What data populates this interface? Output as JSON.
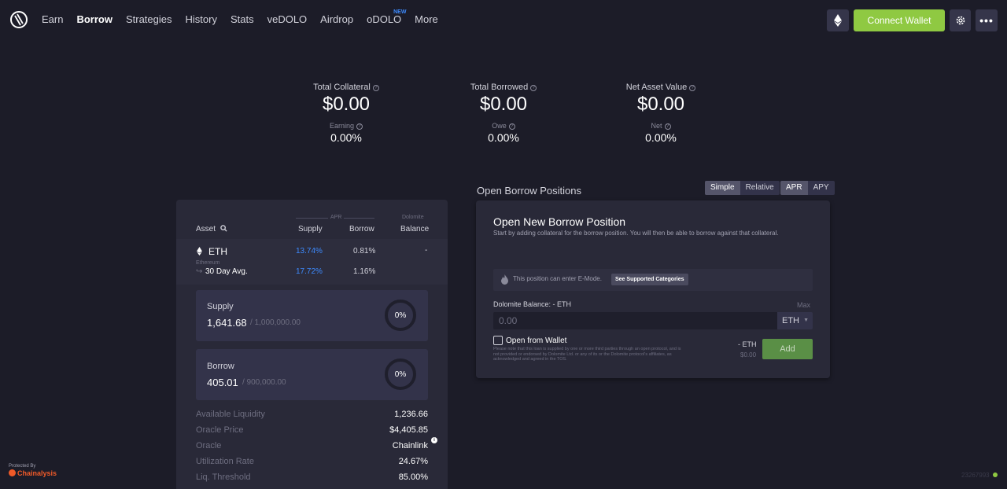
{
  "nav": {
    "links": [
      {
        "label": "Earn",
        "active": false
      },
      {
        "label": "Borrow",
        "active": true
      },
      {
        "label": "Strategies",
        "active": false
      },
      {
        "label": "History",
        "active": false
      },
      {
        "label": "Stats",
        "active": false
      },
      {
        "label": "veDOLO",
        "active": false
      },
      {
        "label": "Airdrop",
        "active": false
      },
      {
        "label": "oDOLO",
        "active": false,
        "badge": "NEW"
      },
      {
        "label": "More",
        "active": false
      }
    ],
    "connect_label": "Connect Wallet",
    "more_label": "•••",
    "icons": {
      "network": "ethereum-icon",
      "settings": "gear-icon",
      "logo": "dolomite-logo"
    }
  },
  "summary": [
    {
      "label": "Total Collateral",
      "value": "$0.00",
      "sub_label": "Earning",
      "sub_value": "0.00%"
    },
    {
      "label": "Total Borrowed",
      "value": "$0.00",
      "sub_label": "Owe",
      "sub_value": "0.00%"
    },
    {
      "label": "Net Asset Value",
      "value": "$0.00",
      "sub_label": "Net",
      "sub_value": "0.00%"
    }
  ],
  "market": {
    "header": {
      "asset": "Asset",
      "apr": "APR",
      "supply": "Supply",
      "borrow": "Borrow",
      "balance_top": "Dolomite",
      "balance": "Balance"
    },
    "row": {
      "symbol": "ETH",
      "name": "Ethereum",
      "supply_apr": "13.74%",
      "borrow_apr": "0.81%",
      "balance": "-"
    },
    "avg": {
      "label": "30 Day Avg.",
      "supply_apr": "17.72%",
      "borrow_apr": "1.16%"
    },
    "supply_card": {
      "label": "Supply",
      "amount": "1,641.68",
      "cap": "/ 1,000,000.00",
      "pct": "0%"
    },
    "borrow_card": {
      "label": "Borrow",
      "amount": "405.01",
      "cap": "/ 900,000.00",
      "pct": "0%"
    },
    "stats": [
      {
        "key": "Available Liquidity",
        "value": "1,236.66"
      },
      {
        "key": "Oracle Price",
        "value": "$4,405.85"
      },
      {
        "key": "Oracle",
        "value": "Chainlink"
      },
      {
        "key": "Utilization Rate",
        "value": "24.67%"
      },
      {
        "key": "Liq. Threshold",
        "value": "85.00%"
      }
    ]
  },
  "positions": {
    "title": "Open Borrow Positions",
    "mode_toggle": [
      "Simple",
      "Relative"
    ],
    "mode_active": "Simple",
    "rate_toggle": [
      "APR",
      "APY"
    ],
    "rate_active": "APR"
  },
  "new_position": {
    "title": "Open New Borrow Position",
    "subtitle": "Start by adding collateral for the borrow position. You will then be able to borrow against that collateral.",
    "emode_text": "This position can enter E-Mode.",
    "emode_button": "See Supported Categories",
    "balance_label": "Dolomite Balance: - ETH",
    "max_label": "Max",
    "input_placeholder": "0.00",
    "token": "ETH",
    "wallet_label": "Open from Wallet",
    "disclaimer": "Please note that this loan is supplied by one or more third parties through an open protocol, and is not provided or endorsed by Dolomite Ltd. or any of its or the Dolomite protocol's affiliates, as acknowledged and agreed in the TOS.",
    "amount_eth": "- ETH",
    "amount_usd": "$0.00",
    "add_label": "Add"
  },
  "footer": {
    "protected_by": "Protected By",
    "brand": "Chainalysis",
    "version": "23267993"
  }
}
